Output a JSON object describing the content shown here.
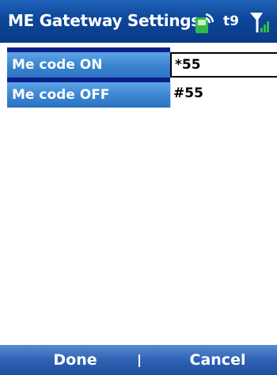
{
  "titlebar": {
    "title": "ME Gatetway Settings",
    "t9": "t9",
    "phone_icon": "phone-icon",
    "signal_icon": "signal-icon"
  },
  "fields": [
    {
      "label": "Me code ON",
      "value": "*55",
      "focused": true
    },
    {
      "label": "Me code OFF",
      "value": "#55",
      "focused": false
    }
  ],
  "softkeys": {
    "left": "Done",
    "right": "Cancel"
  },
  "colors": {
    "title_bar": "#0c4699",
    "label_bg": "#3c86d2",
    "stripe": "#0a1f8a",
    "softkey_bar": "#2f62b4",
    "phone_green": "#35b84a"
  }
}
